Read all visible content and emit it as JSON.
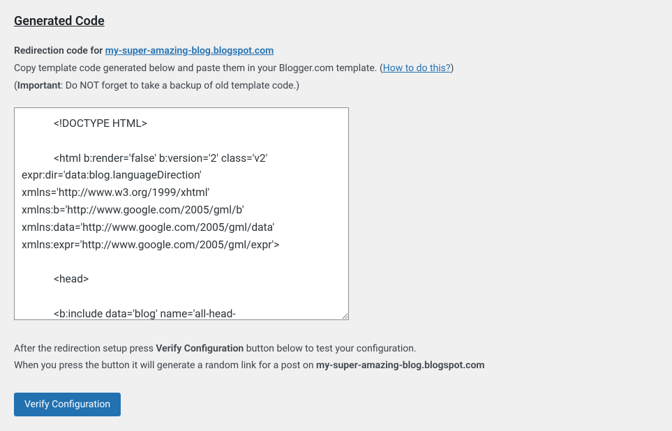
{
  "heading": "Generated Code",
  "intro": {
    "redirection_prefix": "Redirection code for ",
    "blog_link": "my-super-amazing-blog.blogspot.com",
    "copy_instruction_before": "Copy template code generated below and paste them in your Blogger.com template. (",
    "how_to_link": "How to do this?",
    "copy_instruction_after": ")",
    "important_open": "(",
    "important_label": "Important",
    "important_rest": ": Do NOT forget to take a backup of old template code.)"
  },
  "code_textarea": "            <!DOCTYPE HTML>\n\n            <html b:render='false' b:version='2' class='v2' expr:dir='data:blog.languageDirection' xmlns='http://www.w3.org/1999/xhtml' xmlns:b='http://www.google.com/2005/gml/b' xmlns:data='http://www.google.com/2005/gml/data' xmlns:expr='http://www.google.com/2005/gml/expr'>\n\n            <head>\n\n            <b:include data='blog' name='all-head-",
  "post": {
    "line1_before": "After the redirection setup press ",
    "line1_strong": "Verify Configuration",
    "line1_after": " button below to test your configuration.",
    "line2_before": "When you press the button it will generate a random link for a post on ",
    "line2_strong": "my-super-amazing-blog.blogspot.com"
  },
  "button": {
    "verify_label": "Verify Configuration"
  }
}
